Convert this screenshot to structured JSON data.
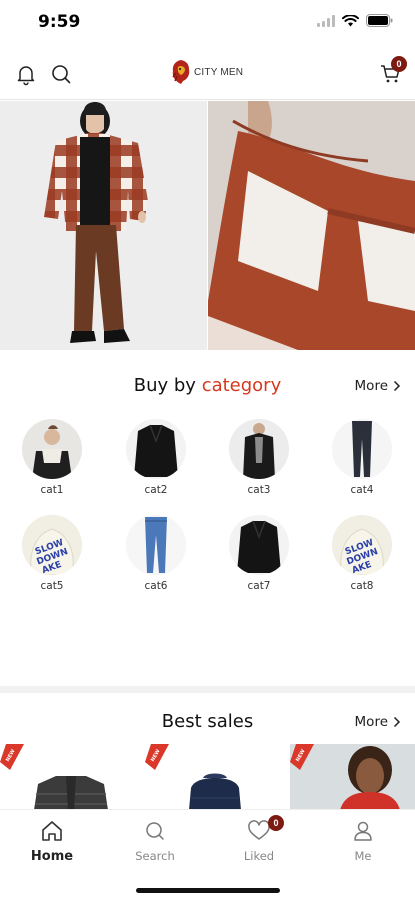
{
  "status_bar": {
    "time": "9:59"
  },
  "header": {
    "brand_name": "CITY MEN",
    "cart_count": "0",
    "icons": [
      "bell-icon",
      "search-icon",
      "cart-icon"
    ]
  },
  "hero": {
    "slides": [
      "model-full-outfit",
      "plaid-shirt-closeup"
    ]
  },
  "category_section": {
    "title_prefix": "Buy by ",
    "title_accent": "category",
    "more_label": "More",
    "accent_color": "#d6381d"
  },
  "categories": [
    {
      "label": "cat1",
      "image": "shirt-model"
    },
    {
      "label": "cat2",
      "image": "black-jacket"
    },
    {
      "label": "cat3",
      "image": "black-coat"
    },
    {
      "label": "cat4",
      "image": "dark-trousers"
    },
    {
      "label": "cat5",
      "image": "print-hoodie"
    },
    {
      "label": "cat6",
      "image": "blue-jeans"
    },
    {
      "label": "cat7",
      "image": "black-jacket"
    },
    {
      "label": "cat8",
      "image": "print-hoodie"
    }
  ],
  "best_sales": {
    "title": "Best sales",
    "more_label": "More",
    "products": [
      {
        "image": "grey-puffer-vest",
        "badge": "new-ribbon"
      },
      {
        "image": "navy-puffer-jacket",
        "badge": "new-ribbon"
      },
      {
        "image": "red-hoodie-model",
        "badge": "new-ribbon"
      }
    ]
  },
  "tabbar": {
    "tabs": [
      {
        "label": "Home",
        "icon": "home-icon",
        "active": true
      },
      {
        "label": "Search",
        "icon": "search-icon",
        "active": false
      },
      {
        "label": "Liked",
        "icon": "heart-icon",
        "active": false
      },
      {
        "label": "Me",
        "icon": "user-icon",
        "active": false
      }
    ],
    "liked_count": "0"
  },
  "colors": {
    "badge": "#7d1b12",
    "accent": "#d6381d",
    "plaid": "#9b3a22"
  }
}
